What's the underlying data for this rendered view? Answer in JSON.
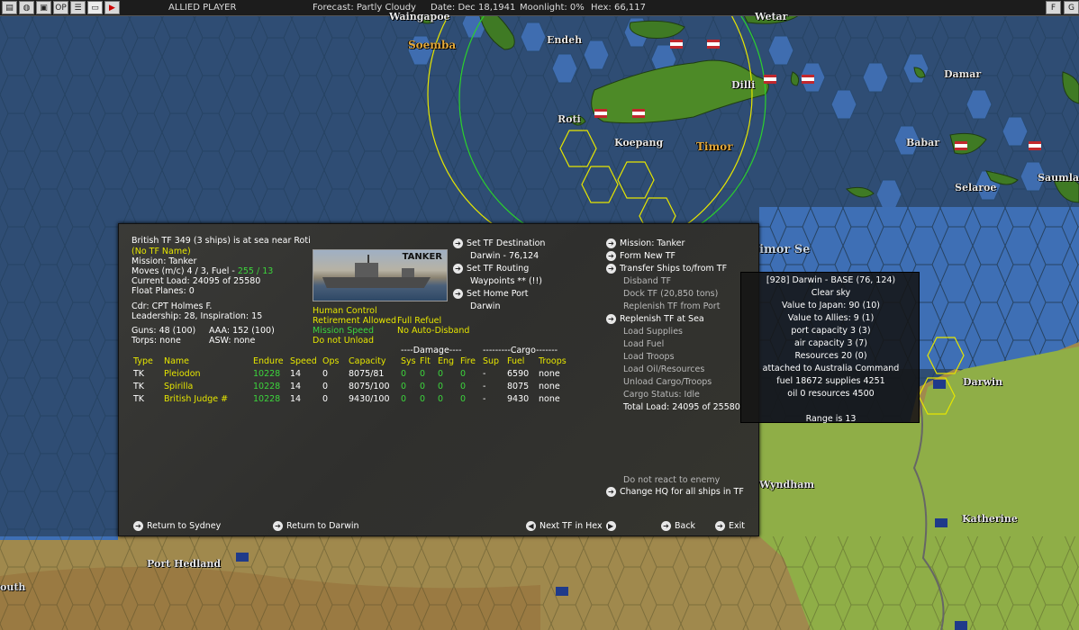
{
  "toolbar": {
    "player": "ALLIED PLAYER",
    "forecast": "Forecast: Partly Cloudy",
    "date": "Date: Dec 18,1941",
    "moonlight": "Moonlight: 0%",
    "hex": "Hex: 66,117",
    "icons": [
      "OP",
      "▶"
    ],
    "right_icons": [
      "F",
      "G"
    ]
  },
  "map": {
    "places": [
      {
        "name": "Waingapoe",
        "style": "normal"
      },
      {
        "name": "Soemba",
        "style": "gold"
      },
      {
        "name": "Endeh",
        "style": "normal"
      },
      {
        "name": "Wetar",
        "style": "normal"
      },
      {
        "name": "Dilli",
        "style": "normal"
      },
      {
        "name": "Damar",
        "style": "normal"
      },
      {
        "name": "Roti",
        "style": "normal"
      },
      {
        "name": "Koepang",
        "style": "normal"
      },
      {
        "name": "Timor",
        "style": "gold"
      },
      {
        "name": "Babar",
        "style": "normal"
      },
      {
        "name": "Selaroe",
        "style": "normal"
      },
      {
        "name": "Saumla",
        "style": "normal"
      },
      {
        "name": "imor Se",
        "style": "dark"
      },
      {
        "name": "Darwin",
        "style": "normal"
      },
      {
        "name": "Wyndham",
        "style": "normal"
      },
      {
        "name": "Katherine",
        "style": "normal"
      },
      {
        "name": "Port Hedland",
        "style": "normal"
      },
      {
        "name": "outh",
        "style": "normal"
      }
    ]
  },
  "panel": {
    "tf_title": "British TF 349 (3 ships) is at sea near Roti",
    "tf_name": "(No TF Name)",
    "mission": "Mission: Tanker",
    "moves_prefix": "Moves (m/c)  4 / 3, Fuel - ",
    "moves_fuel": "255 / 13",
    "current_load": "Current Load:  24095 of 25580",
    "float_planes": "Float Planes:  0",
    "commander": "Cdr: CPT  Holmes F.",
    "leadership": "Leadership: 28, Inspiration: 15",
    "guns": "Guns: 48 (100)",
    "aaa": "AAA: 152 (100)",
    "torps": "Torps: none",
    "asw": "ASW: none",
    "ship_image_label": "TANKER",
    "orders": {
      "human_control": "Human Control",
      "retirement": "Retirement Allowed",
      "full_refuel": "Full Refuel",
      "mission_speed": "Mission Speed",
      "no_auto_disband": "No Auto-Disband",
      "do_not_unload": "Do not Unload"
    },
    "destination": {
      "set_dest": "Set TF Destination",
      "dest_value": "Darwin - 76,124",
      "set_routing": "Set TF Routing",
      "waypoints": "Waypoints  ** (!!)",
      "set_home": "Set Home Port",
      "home_value": "Darwin"
    },
    "actions": [
      {
        "label": "Mission: Tanker",
        "active": true
      },
      {
        "label": "Form New TF",
        "active": true
      },
      {
        "label": "Transfer Ships to/from TF",
        "active": true
      },
      {
        "label": "Disband TF",
        "active": false
      },
      {
        "label": "Dock TF (20,850 tons)",
        "active": false
      },
      {
        "label": "Replenish TF from Port",
        "active": false
      },
      {
        "label": "Replenish TF at Sea",
        "active": true
      },
      {
        "label": "Load Supplies",
        "active": false
      },
      {
        "label": "Load Fuel",
        "active": false
      },
      {
        "label": "Load Troops",
        "active": false
      },
      {
        "label": "Load Oil/Resources",
        "active": false
      },
      {
        "label": "Unload Cargo/Troops",
        "active": false
      },
      {
        "label": "Cargo Status: Idle",
        "active": false
      },
      {
        "label": "Total Load: 24095 of 25580",
        "active": false
      }
    ],
    "react": "Do not react to enemy",
    "change_hq": "Change HQ for all ships in TF",
    "table": {
      "damage_header": "----Damage----",
      "cargo_header": "---------Cargo-------",
      "headers": [
        "Type",
        "Name",
        "Endure",
        "Speed",
        "Ops",
        "Capacity",
        "Sys",
        "Flt",
        "Eng",
        "Fire",
        "Sup",
        "Fuel",
        "Troops"
      ],
      "rows": [
        [
          "TK",
          "Pleiodon",
          "10228",
          "14",
          "0",
          "8075/81",
          "0",
          "0",
          "0",
          "0",
          "-",
          "6590",
          "none"
        ],
        [
          "TK",
          "Spirilla",
          "10228",
          "14",
          "0",
          "8075/100",
          "0",
          "0",
          "0",
          "0",
          "-",
          "8075",
          "none"
        ],
        [
          "TK",
          "British Judge #",
          "10228",
          "14",
          "0",
          "9430/100",
          "0",
          "0",
          "0",
          "0",
          "-",
          "9430",
          "none"
        ]
      ]
    },
    "bottom": {
      "return_sydney": "Return to Sydney",
      "return_darwin": "Return to Darwin",
      "next_tf": "Next TF in Hex",
      "back": "Back",
      "exit": "Exit"
    }
  },
  "base_info": {
    "lines": [
      "[928] Darwin  - BASE  (76, 124)",
      "Clear sky",
      "Value to Japan: 90 (10)",
      "Value to Allies: 9 (1)",
      "port capacity 3 (3)",
      "air capacity 3 (7)",
      "Resources  20 (0)",
      "attached to Australia Command",
      "fuel 18672  supplies 4251",
      "oil 0  resources 4500",
      "",
      "Range is 13"
    ]
  }
}
